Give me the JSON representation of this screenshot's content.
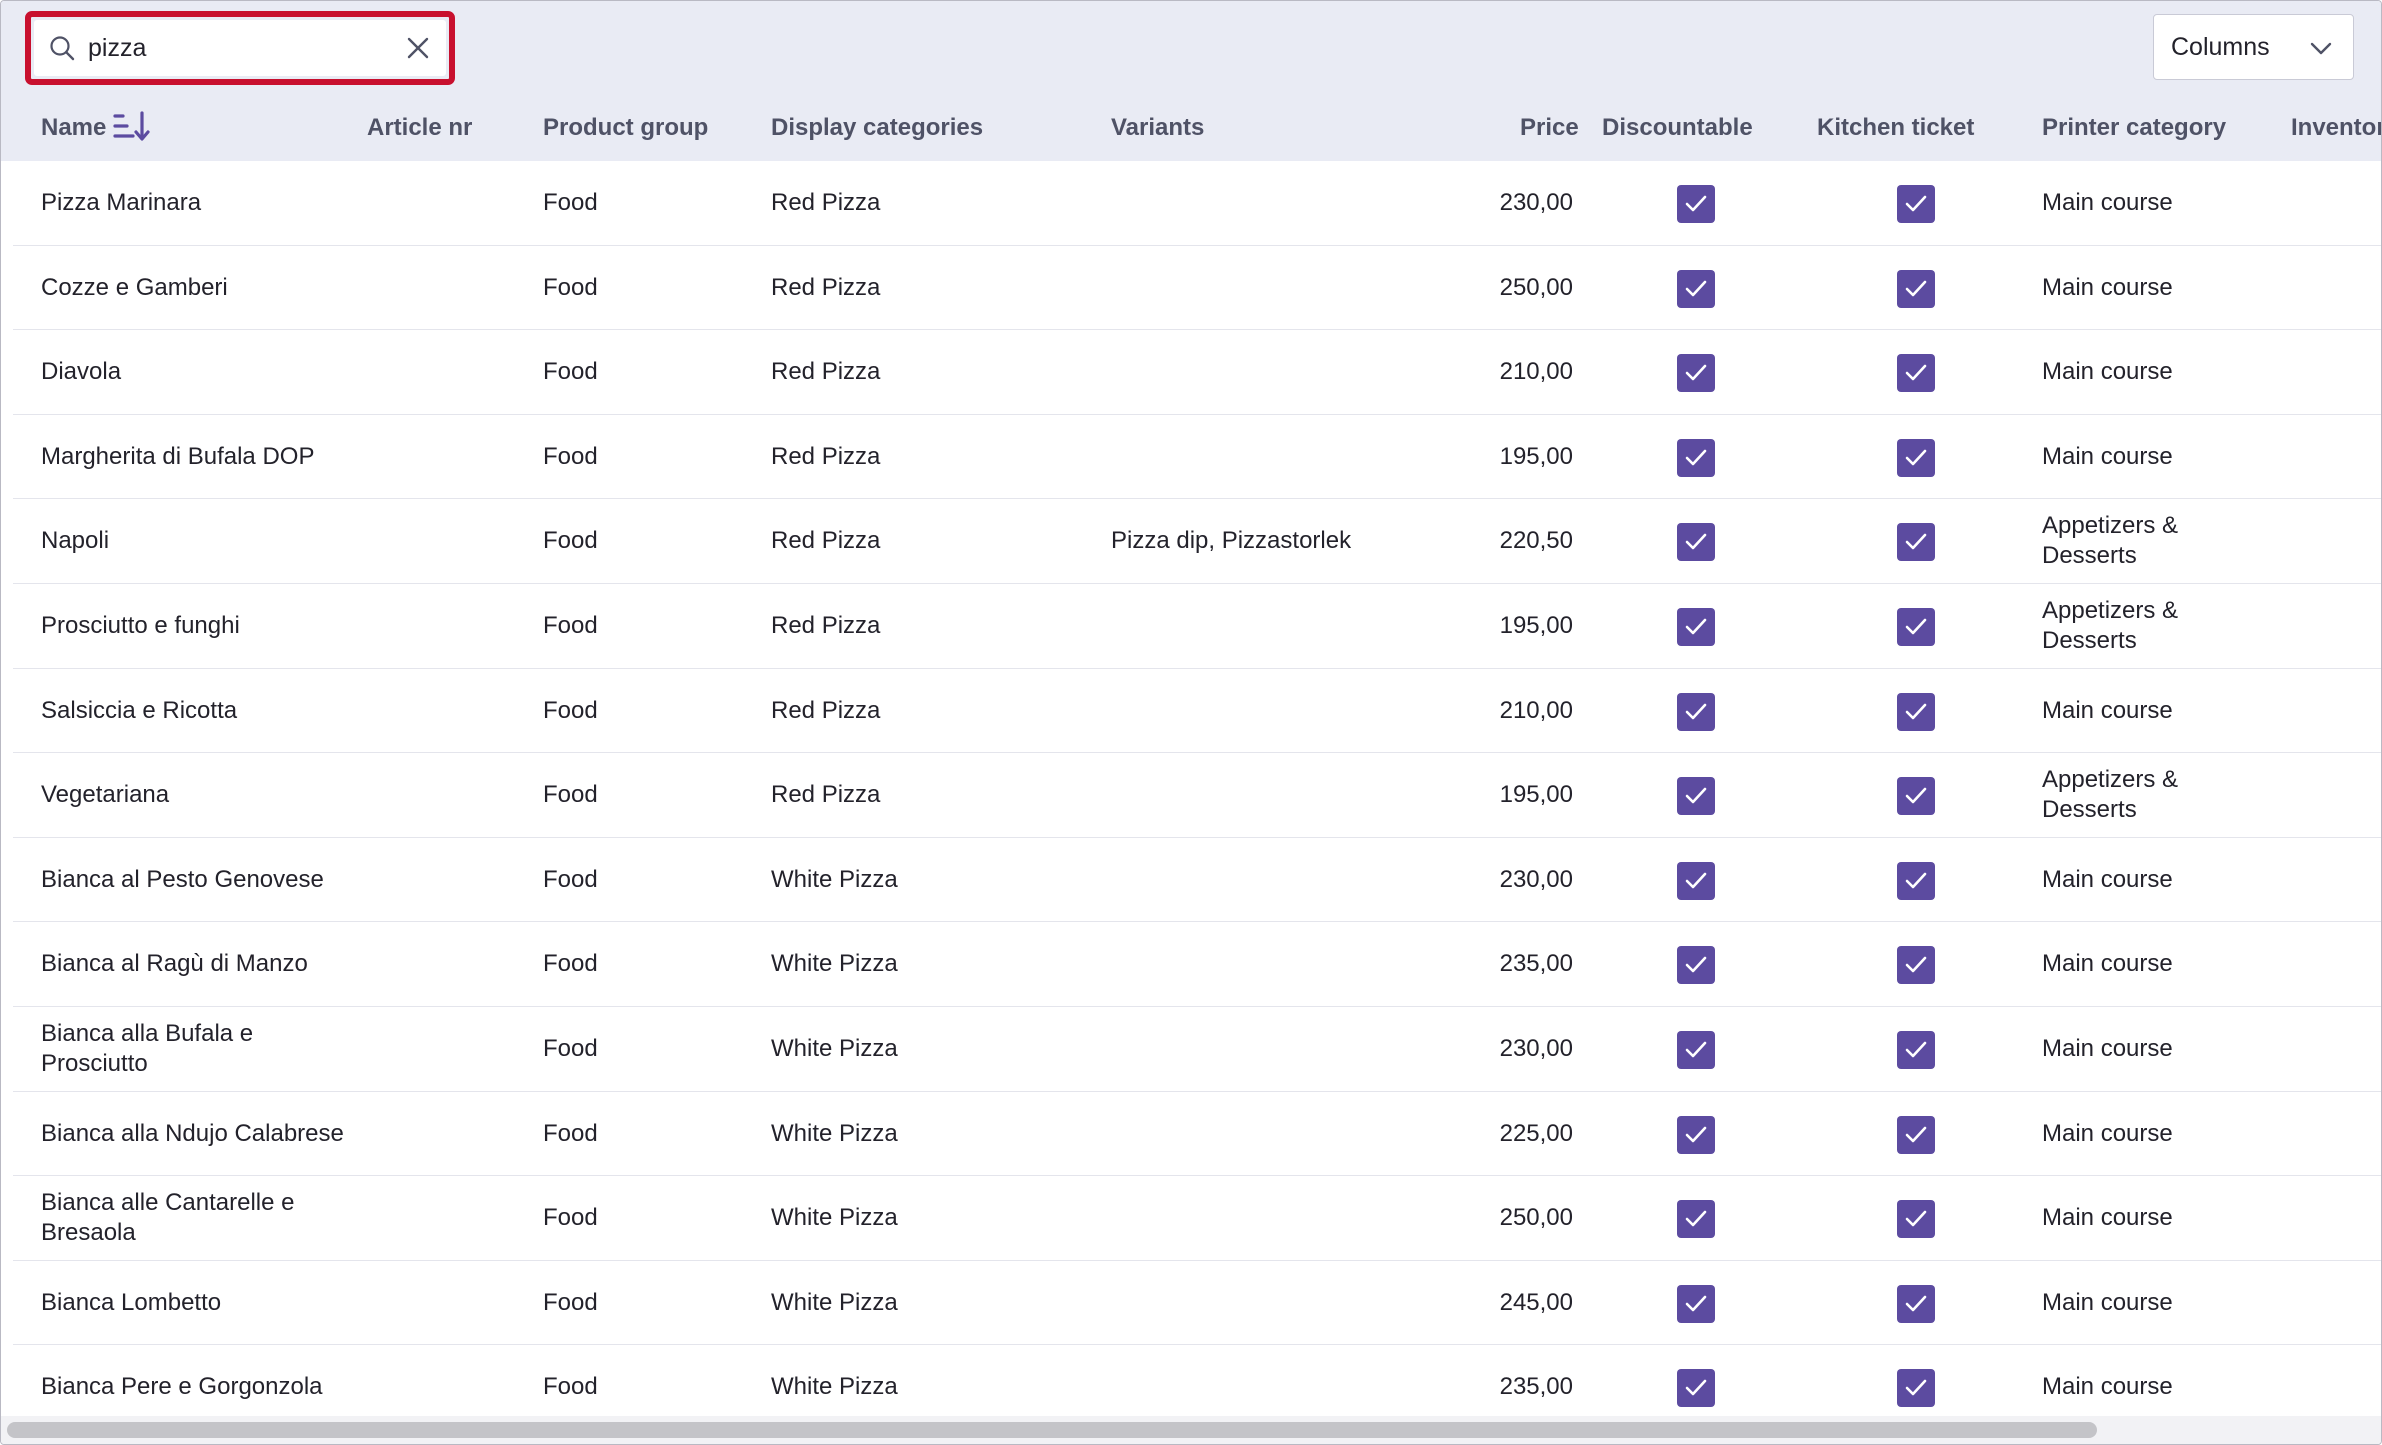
{
  "search": {
    "value": "pizza",
    "icon": "search-icon",
    "clear_icon": "close-icon"
  },
  "columns_button": {
    "label": "Columns",
    "icon": "chevron-down-icon"
  },
  "colors": {
    "accent": "#5c4ba0",
    "highlight": "#c8102e",
    "toolbar_bg": "#e9ebf4"
  },
  "table": {
    "headers": {
      "name": "Name",
      "article_nr": "Article nr",
      "product_group": "Product group",
      "display_categories": "Display categories",
      "variants": "Variants",
      "price": "Price",
      "discountable": "Discountable",
      "kitchen_ticket": "Kitchen ticket",
      "printer_category": "Printer category",
      "inventory": "Inventor"
    },
    "sort": {
      "column": "Name",
      "icon": "sort-descending-icon"
    },
    "rows": [
      {
        "name": "Pizza Marinara",
        "group": "Food",
        "display": "Red Pizza",
        "variants": "",
        "price": "230,00",
        "discountable": true,
        "kitchen": true,
        "printer": "Main course"
      },
      {
        "name": "Cozze e Gamberi",
        "group": "Food",
        "display": "Red Pizza",
        "variants": "",
        "price": "250,00",
        "discountable": true,
        "kitchen": true,
        "printer": "Main course"
      },
      {
        "name": "Diavola",
        "group": "Food",
        "display": "Red Pizza",
        "variants": "",
        "price": "210,00",
        "discountable": true,
        "kitchen": true,
        "printer": "Main course"
      },
      {
        "name": "Margherita di Bufala DOP",
        "group": "Food",
        "display": "Red Pizza",
        "variants": "",
        "price": "195,00",
        "discountable": true,
        "kitchen": true,
        "printer": "Main course"
      },
      {
        "name": "Napoli",
        "group": "Food",
        "display": "Red Pizza",
        "variants": "Pizza dip, Pizzastorlek",
        "price": "220,50",
        "discountable": true,
        "kitchen": true,
        "printer": "Appetizers & Desserts"
      },
      {
        "name": "Prosciutto e funghi",
        "group": "Food",
        "display": "Red Pizza",
        "variants": "",
        "price": "195,00",
        "discountable": true,
        "kitchen": true,
        "printer": "Appetizers & Desserts"
      },
      {
        "name": "Salsiccia e Ricotta",
        "group": "Food",
        "display": "Red Pizza",
        "variants": "",
        "price": "210,00",
        "discountable": true,
        "kitchen": true,
        "printer": "Main course"
      },
      {
        "name": "Vegetariana",
        "group": "Food",
        "display": "Red Pizza",
        "variants": "",
        "price": "195,00",
        "discountable": true,
        "kitchen": true,
        "printer": "Appetizers & Desserts"
      },
      {
        "name": "Bianca al Pesto Genovese",
        "group": "Food",
        "display": "White Pizza",
        "variants": "",
        "price": "230,00",
        "discountable": true,
        "kitchen": true,
        "printer": "Main course"
      },
      {
        "name": "Bianca al Ragù di Manzo",
        "group": "Food",
        "display": "White Pizza",
        "variants": "",
        "price": "235,00",
        "discountable": true,
        "kitchen": true,
        "printer": "Main course"
      },
      {
        "name": "Bianca alla Bufala e Prosciutto",
        "group": "Food",
        "display": "White Pizza",
        "variants": "",
        "price": "230,00",
        "discountable": true,
        "kitchen": true,
        "printer": "Main course"
      },
      {
        "name": "Bianca alla Ndujo Calabrese",
        "group": "Food",
        "display": "White Pizza",
        "variants": "",
        "price": "225,00",
        "discountable": true,
        "kitchen": true,
        "printer": "Main course"
      },
      {
        "name": "Bianca alle Cantarelle e Bresaola",
        "group": "Food",
        "display": "White Pizza",
        "variants": "",
        "price": "250,00",
        "discountable": true,
        "kitchen": true,
        "printer": "Main course"
      },
      {
        "name": "Bianca Lombetto",
        "group": "Food",
        "display": "White Pizza",
        "variants": "",
        "price": "245,00",
        "discountable": true,
        "kitchen": true,
        "printer": "Main course"
      },
      {
        "name": "Bianca Pere e Gorgonzola",
        "group": "Food",
        "display": "White Pizza",
        "variants": "",
        "price": "235,00",
        "discountable": true,
        "kitchen": true,
        "printer": "Main course"
      }
    ]
  }
}
